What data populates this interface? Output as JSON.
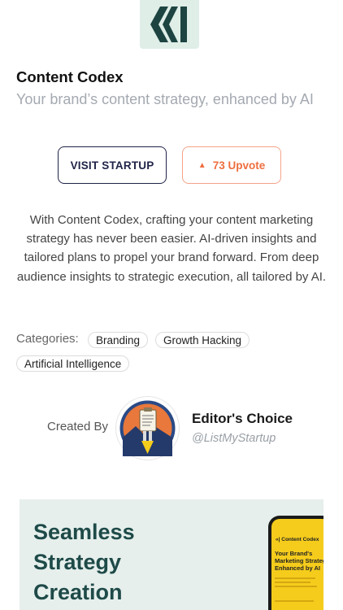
{
  "app": {
    "title": "Content Codex",
    "tagline": "Your brand’s content strategy, enhanced by AI",
    "logo_icon": "content-codex-chevrons-logo",
    "logo_bg": "#dfeee7"
  },
  "actions": {
    "visit_label": "VISIT STARTUP",
    "upvote_label": "73 Upvote",
    "upvote_icon": "triangle-up-icon",
    "upvote_color": "#ee6e3f"
  },
  "description": "With Content Codex, crafting your content marketing strategy has never been easier. AI-driven insights and tailored plans to propel your brand forward. From deep audience insights to strategic execution, all tailored by AI.",
  "categories": {
    "label": "Categories:",
    "items": [
      "Branding",
      "Growth Hacking",
      "Artificial Intelligence"
    ]
  },
  "creator": {
    "created_by_label": "Created By",
    "name": "Editor's Choice",
    "handle": "@ListMyStartup",
    "avatar_icon": "rocket-clipboard-avatar"
  },
  "banner": {
    "headline_lines": [
      "Seamless",
      "Strategy",
      "Creation"
    ],
    "phone_brand": "Content Codex",
    "phone_headline_lines": [
      "Your Brand's",
      "Marketing Strategy,",
      "Enhanced by AI"
    ],
    "accent_yellow": "#f5cc1c"
  }
}
